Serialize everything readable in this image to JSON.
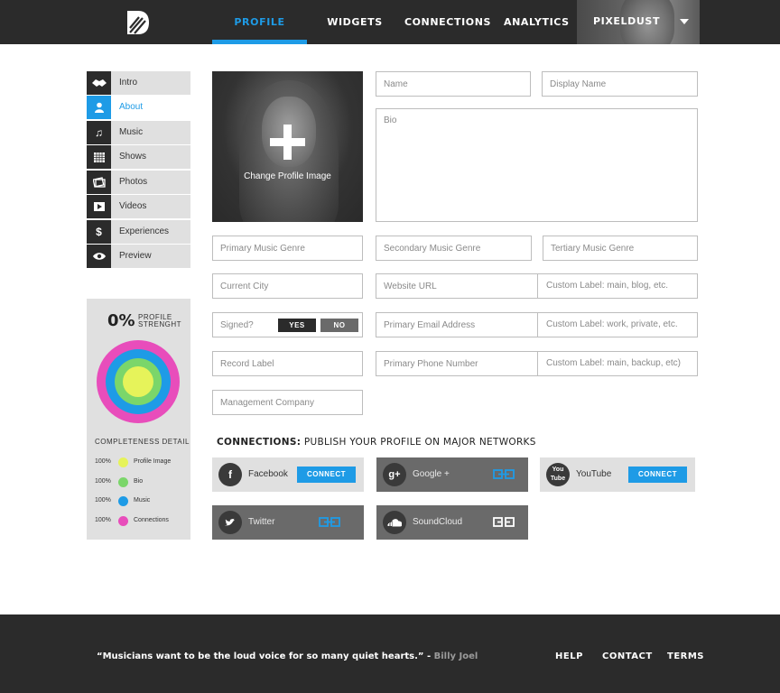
{
  "header": {
    "logo": "brand-logo",
    "nav": [
      "PROFILE",
      "WIDGETS",
      "CONNECTIONS",
      "ANALYTICS"
    ],
    "active_nav": "PROFILE",
    "user_name": "PIXELDUST",
    "accent": "#1e9be6"
  },
  "sidebar": {
    "items": [
      {
        "label": "Intro",
        "icon": "handshake-icon"
      },
      {
        "label": "About",
        "icon": "person-icon",
        "active": true
      },
      {
        "label": "Music",
        "icon": "music-note-icon"
      },
      {
        "label": "Shows",
        "icon": "calendar-icon"
      },
      {
        "label": "Photos",
        "icon": "photos-icon"
      },
      {
        "label": "Videos",
        "icon": "play-icon"
      },
      {
        "label": "Experiences",
        "icon": "dollar-icon"
      },
      {
        "label": "Preview",
        "icon": "eye-icon"
      }
    ]
  },
  "strength": {
    "percent": "0%",
    "label_line1": "PROFILE",
    "label_line2": "STRENGHT",
    "detail_title": "COMPLETENESS DETAIL",
    "details": [
      {
        "pct": "100%",
        "name": "Profile Image",
        "color": "#e6f35a"
      },
      {
        "pct": "100%",
        "name": "Bio",
        "color": "#7bd66a"
      },
      {
        "pct": "100%",
        "name": "Music",
        "color": "#1e9be6"
      },
      {
        "pct": "100%",
        "name": "Connections",
        "color": "#e84dbb"
      }
    ]
  },
  "profile_image": {
    "label": "Change Profile Image"
  },
  "form": {
    "name": "Name",
    "display_name": "Display Name",
    "bio": "Bio",
    "primary_genre": "Primary Music Genre",
    "secondary_genre": "Secondary Music Genre",
    "tertiary_genre": "Tertiary Music Genre",
    "current_city": "Current City",
    "website_url": "Website URL",
    "website_label": "Custom Label: main, blog, etc.",
    "signed": "Signed?",
    "signed_yes": "YES",
    "signed_no": "NO",
    "primary_email": "Primary Email Address",
    "email_label": "Custom Label: work, private, etc.",
    "record_label": "Record Label",
    "primary_phone": "Primary Phone Number",
    "phone_label": "Custom Label: main, backup, etc)",
    "management": "Management Company"
  },
  "connections": {
    "title_bold": "CONNECTIONS:",
    "title_rest": " PUBLISH YOUR PROFILE ON MAJOR NETWORKS",
    "connect_label": "CONNECT",
    "services": [
      {
        "name": "Facebook",
        "icon": "facebook-icon",
        "state": "connect"
      },
      {
        "name": "Google +",
        "icon": "google-plus-icon",
        "state": "linked"
      },
      {
        "name": "YouTube",
        "icon": "youtube-icon",
        "state": "connect"
      },
      {
        "name": "Twitter",
        "icon": "twitter-icon",
        "state": "linked"
      },
      {
        "name": "SoundCloud",
        "icon": "soundcloud-icon",
        "state": "linked"
      }
    ]
  },
  "footer": {
    "quote": "“Musicians want to be the loud voice for so many quiet hearts.” -",
    "author": " Billy Joel",
    "links": [
      "HELP",
      "CONTACT",
      "TERMS"
    ]
  }
}
